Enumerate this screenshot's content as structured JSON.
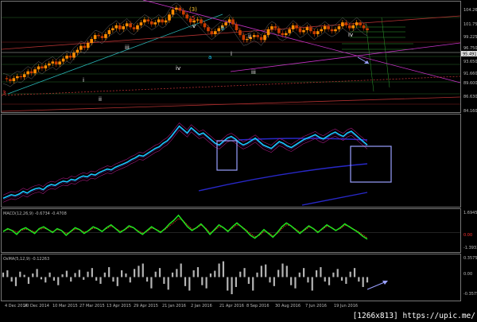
{
  "chart_data": [
    {
      "type": "line",
      "panel": "price",
      "ylim": [
        94.16,
        104.26
      ],
      "y_ticks": [
        "104.260",
        "101.755",
        "99.225",
        "96.750",
        "95.491",
        "93.650",
        "91.660",
        "89.600",
        "86.630",
        "84.160"
      ],
      "last_price_label": "95.491",
      "trend": [
        96.9,
        96.8,
        96.6,
        96.9,
        97.1,
        97.0,
        97.3,
        97.6,
        97.4,
        97.8,
        98.1,
        97.9,
        98.2,
        98.4,
        98.6,
        98.3,
        98.6,
        98.9,
        99.2,
        99.0,
        99.5,
        99.8,
        100.2,
        100.0,
        100.5,
        100.9,
        101.3,
        101.2,
        101.0,
        101.4,
        101.8,
        102.0,
        102.3,
        101.9,
        102.2,
        102.5,
        102.1,
        101.9,
        102.3,
        102.6,
        102.9,
        102.7,
        102.4,
        102.6,
        102.9,
        102.6,
        102.8,
        103.4,
        103.9,
        104.1,
        103.8,
        103.4,
        103.0,
        102.6,
        102.8,
        102.9,
        102.5,
        102.1,
        101.7,
        101.4,
        101.7,
        102.0,
        102.3,
        102.6,
        102.9,
        102.4,
        101.8,
        101.3,
        100.8,
        100.9,
        101.1,
        101.3,
        101.1,
        100.8,
        101.3,
        101.9,
        102.2,
        102.0,
        101.5,
        101.3,
        101.5,
        101.9,
        102.3,
        102.0,
        101.6,
        101.8,
        102.1,
        101.7,
        101.4,
        101.7,
        101.9,
        102.2,
        101.9,
        101.7,
        101.9,
        102.2,
        102.6,
        102.3,
        102.0,
        102.3,
        102.6,
        102.3,
        102.0,
        101.8
      ]
    },
    {
      "type": "line",
      "panel": "oscillator",
      "values": [
        0.08,
        0.1,
        0.12,
        0.11,
        0.13,
        0.16,
        0.14,
        0.17,
        0.19,
        0.2,
        0.18,
        0.22,
        0.24,
        0.23,
        0.26,
        0.28,
        0.27,
        0.3,
        0.29,
        0.32,
        0.34,
        0.33,
        0.36,
        0.35,
        0.38,
        0.4,
        0.42,
        0.41,
        0.44,
        0.46,
        0.48,
        0.5,
        0.53,
        0.55,
        0.58,
        0.57,
        0.6,
        0.63,
        0.66,
        0.68,
        0.72,
        0.75,
        0.8,
        0.86,
        0.92,
        0.88,
        0.84,
        0.9,
        0.86,
        0.82,
        0.84,
        0.8,
        0.76,
        0.72,
        0.7,
        0.74,
        0.78,
        0.8,
        0.77,
        0.73,
        0.7,
        0.72,
        0.75,
        0.78,
        0.74,
        0.7,
        0.68,
        0.66,
        0.7,
        0.74,
        0.72,
        0.69,
        0.67,
        0.7,
        0.73,
        0.76,
        0.78,
        0.8,
        0.82,
        0.79,
        0.77,
        0.8,
        0.83,
        0.85,
        0.82,
        0.8,
        0.84,
        0.86,
        0.82,
        0.78,
        0.74,
        0.7
      ]
    },
    {
      "type": "line",
      "panel": "macd",
      "title": "MACD(12,26,9) -0.6734 -0.4708",
      "y_ticks": [
        "1.6945",
        "0.00",
        "-1.3933"
      ],
      "ylim": [
        -1.8,
        2.2
      ],
      "macd": [
        0.1,
        0.4,
        0.2,
        -0.2,
        0.3,
        0.5,
        0.2,
        -0.1,
        0.4,
        0.6,
        0.3,
        0.0,
        0.4,
        0.2,
        -0.3,
        0.1,
        0.5,
        0.3,
        -0.1,
        0.2,
        0.6,
        0.4,
        0.1,
        0.5,
        0.8,
        0.4,
        0.0,
        0.3,
        0.7,
        0.5,
        0.1,
        -0.2,
        0.2,
        0.6,
        0.3,
        0.0,
        0.4,
        0.9,
        1.3,
        1.8,
        1.2,
        0.6,
        0.2,
        0.5,
        0.9,
        0.4,
        -0.2,
        0.3,
        0.8,
        0.5,
        0.1,
        0.6,
        1.0,
        0.6,
        0.2,
        -0.3,
        -0.6,
        -0.2,
        0.3,
        -0.1,
        -0.5,
        0.0,
        0.6,
        1.0,
        0.7,
        0.3,
        -0.1,
        0.3,
        0.7,
        0.4,
        0.0,
        0.4,
        0.8,
        0.5,
        0.2,
        0.5,
        0.9,
        0.6,
        0.3,
        0.0,
        -0.4,
        -0.7
      ],
      "signal": [
        0.15,
        0.3,
        0.25,
        0.05,
        0.2,
        0.35,
        0.25,
        0.05,
        0.3,
        0.45,
        0.3,
        0.1,
        0.3,
        0.2,
        -0.1,
        0.05,
        0.35,
        0.3,
        0.05,
        0.15,
        0.45,
        0.4,
        0.15,
        0.4,
        0.65,
        0.45,
        0.15,
        0.25,
        0.55,
        0.5,
        0.2,
        -0.05,
        0.1,
        0.45,
        0.35,
        0.1,
        0.3,
        0.7,
        1.05,
        1.45,
        1.25,
        0.8,
        0.35,
        0.45,
        0.75,
        0.5,
        0.0,
        0.2,
        0.6,
        0.5,
        0.2,
        0.45,
        0.8,
        0.65,
        0.3,
        -0.1,
        -0.45,
        -0.3,
        0.1,
        0.0,
        -0.35,
        -0.1,
        0.4,
        0.8,
        0.7,
        0.4,
        0.05,
        0.2,
        0.55,
        0.45,
        0.1,
        0.3,
        0.65,
        0.55,
        0.25,
        0.4,
        0.75,
        0.65,
        0.35,
        0.1,
        -0.25,
        -0.55
      ]
    },
    {
      "type": "bar",
      "panel": "osma",
      "title": "OsMA(5,12,9) -0.12263",
      "y_ticks": [
        "0.3575",
        "0.00",
        "-0.3575"
      ],
      "ylim": [
        -0.45,
        0.45
      ],
      "values": [
        0.1,
        0.15,
        -0.1,
        -0.2,
        0.12,
        0.05,
        -0.15,
        0.08,
        0.18,
        -0.05,
        -0.12,
        0.1,
        -0.08,
        -0.18,
        0.06,
        0.14,
        -0.1,
        0.09,
        0.16,
        -0.06,
        0.12,
        0.2,
        -0.08,
        -0.15,
        0.1,
        0.22,
        -0.1,
        -0.2,
        0.15,
        0.08,
        -0.12,
        0.18,
        0.25,
        0.3,
        -0.1,
        -0.25,
        0.12,
        0.2,
        -0.15,
        -0.28,
        0.1,
        0.18,
        0.3,
        -0.2,
        -0.3,
        0.15,
        0.22,
        -0.18,
        -0.25,
        0.08,
        0.14,
        0.3,
        0.35,
        -0.3,
        -0.38,
        -0.22,
        0.12,
        0.2,
        -0.15,
        -0.3,
        0.1,
        0.25,
        0.28,
        -0.12,
        -0.2,
        0.16,
        0.3,
        0.25,
        -0.18,
        -0.25,
        0.1,
        0.2,
        -0.12,
        -0.3,
        0.15,
        0.22,
        -0.1,
        -0.18,
        0.1,
        0.18,
        -0.08,
        -0.15,
        0.12,
        0.2,
        -0.1,
        -0.22,
        -0.12
      ]
    }
  ],
  "wave_labels": {
    "impulse_top": "(3)",
    "wave_5": "5",
    "wave_3_start": "3",
    "wave_iii": "iii",
    "wave_i": "i",
    "wave_ii": "ii",
    "wave_iv": "iv",
    "wave_v_top": "v",
    "wave_b": "b",
    "wave_a": "a",
    "wave_i2": "i",
    "wave_ii2": "ii",
    "wave_iii2": "iii",
    "wave_iv2": "iv"
  },
  "x_axis_dates": [
    "4 Dec 2014",
    "20 Dec 2014",
    "10 Mar 2015",
    "27 Mar 2015",
    "13 Apr 2015",
    "29 Apr 2015",
    "21 Jan 2016",
    "2 Jan 2016",
    "21 Apr 2016",
    "8 Sep 2016",
    "30 Aug 2016",
    "7 Jun 2016",
    "19 Jun 2016"
  ],
  "colors": {
    "price_up": "#ff8c00",
    "price_down": "#c83c00",
    "oscillator": "#19c8ff",
    "macd": "#1ee61e",
    "signal": "#d23c1e",
    "osma": "#b4b4b4",
    "box": "#9aa0ff",
    "trendline_magenta": "#c832c8",
    "trendline_teal": "#28b4b4",
    "trendline_red": "#b43232"
  },
  "footer": "[1266x813] https://upic.me/"
}
